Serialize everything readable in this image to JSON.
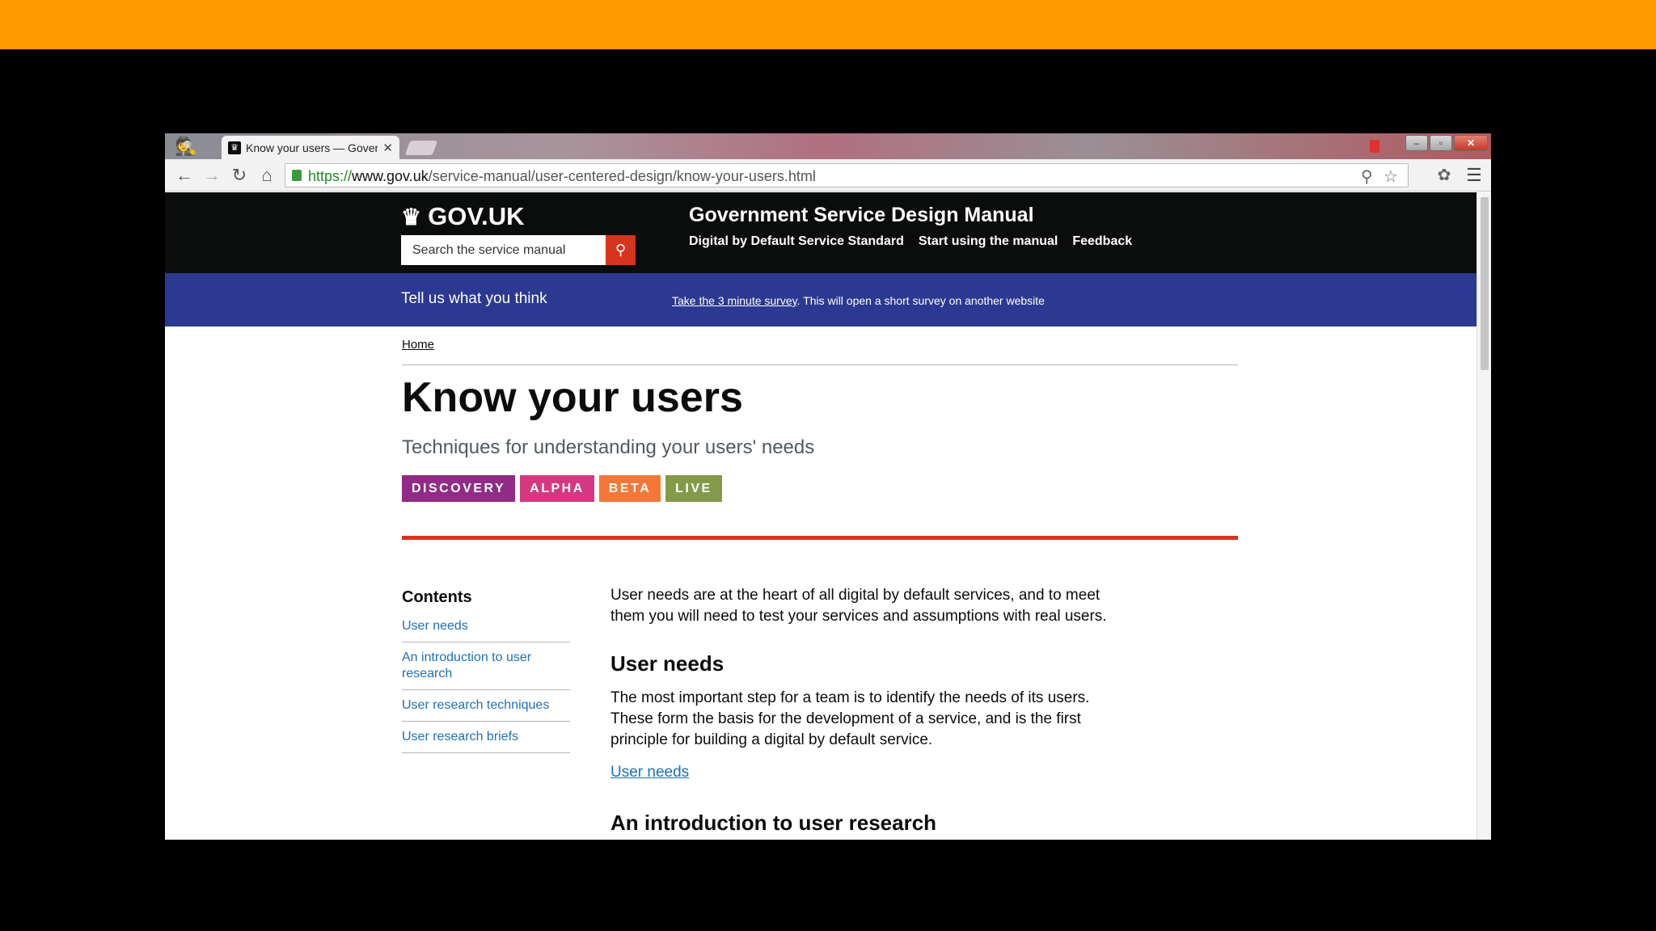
{
  "browser": {
    "tab_title": "Know your users — Government Service Design Manual",
    "url_scheme": "https://",
    "url_host": "www.gov.uk",
    "url_path": "/service-manual/user-centered-design/know-your-users.html",
    "window_buttons": {
      "minimize": "–",
      "maximize": "▫",
      "close": "✕"
    }
  },
  "header": {
    "logo_text": "GOV.UK",
    "search_placeholder": "Search the service manual",
    "manual_title": "Government Service Design Manual",
    "nav": [
      "Digital by Default Service Standard",
      "Start using the manual",
      "Feedback"
    ]
  },
  "survey": {
    "title": "Tell us what you think",
    "link_text": "Take the 3 minute survey",
    "suffix": ". This will open a short survey on another website"
  },
  "page": {
    "breadcrumb": "Home",
    "title": "Know your users",
    "subtitle": "Techniques for understanding your users' needs",
    "phases": [
      {
        "label": "DISCOVERY",
        "color": "#912b88"
      },
      {
        "label": "ALPHA",
        "color": "#d53880"
      },
      {
        "label": "BETA",
        "color": "#f47738"
      },
      {
        "label": "LIVE",
        "color": "#85994b"
      }
    ]
  },
  "contents": {
    "heading": "Contents",
    "items": [
      "User needs",
      "An introduction to user research",
      "User research techniques",
      "User research briefs"
    ]
  },
  "main": {
    "intro": "User needs are at the heart of all digital by default services, and to meet them you will need to test your services and assumptions with real users.",
    "user_needs_heading": "User needs",
    "user_needs_body": "The most important step for a team is to identify the needs of its users. These form the basis for the development of a service, and is the first principle for building a digital by default service.",
    "user_needs_link": "User needs",
    "intro_research_heading": "An introduction to user research"
  },
  "colors": {
    "top_bar": "#fe9a00",
    "survey_bar": "#2b3990",
    "search_button": "#d4351c",
    "rule": "#d4351c"
  }
}
